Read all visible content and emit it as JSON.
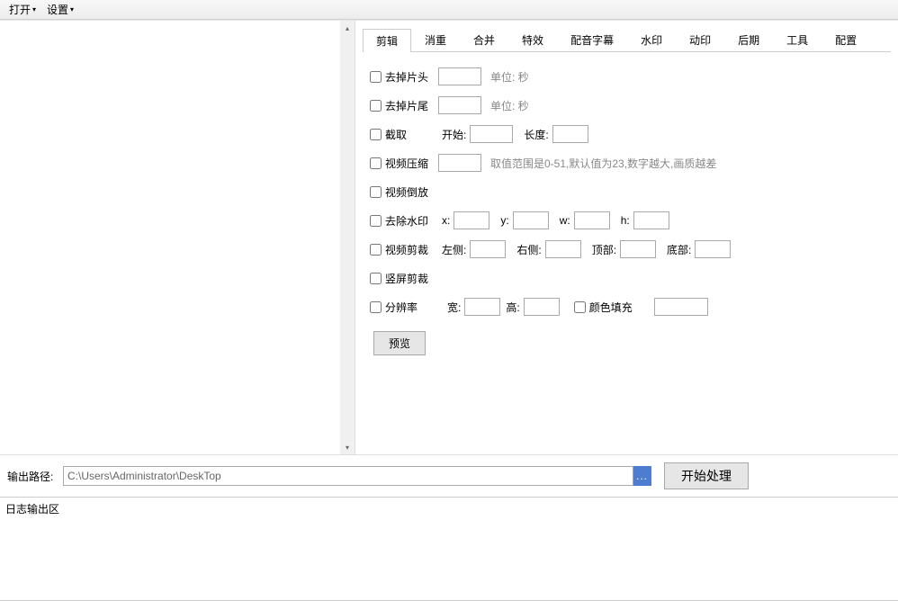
{
  "menu": {
    "open": "打开",
    "settings": "设置"
  },
  "tabs": [
    "剪辑",
    "消重",
    "合并",
    "特效",
    "配音字幕",
    "水印",
    "动印",
    "后期",
    "工具",
    "配置"
  ],
  "options": {
    "trim_head": "去掉片头",
    "trim_tail": "去掉片尾",
    "unit_sec": "单位: 秒",
    "cut": "截取",
    "start": "开始:",
    "length": "长度:",
    "compress": "视频压缩",
    "compress_hint": "取值范围是0-51,默认值为23,数字越大,画质越差",
    "reverse": "视频倒放",
    "rm_watermark": "去除水印",
    "x": "x:",
    "y": "y:",
    "w": "w:",
    "h": "h:",
    "crop": "视频剪裁",
    "left": "左侧:",
    "right": "右侧:",
    "top": "顶部:",
    "bottom": "底部:",
    "vertical_crop": "竖屏剪裁",
    "resolution": "分辨率",
    "width": "宽:",
    "height": "高:",
    "color_fill": "颜色填充",
    "preview": "预览"
  },
  "output": {
    "label": "输出路径:",
    "path": "C:\\Users\\Administrator\\DeskTop",
    "browse": "...",
    "start": "开始处理"
  },
  "log": {
    "label": "日志输出区"
  }
}
